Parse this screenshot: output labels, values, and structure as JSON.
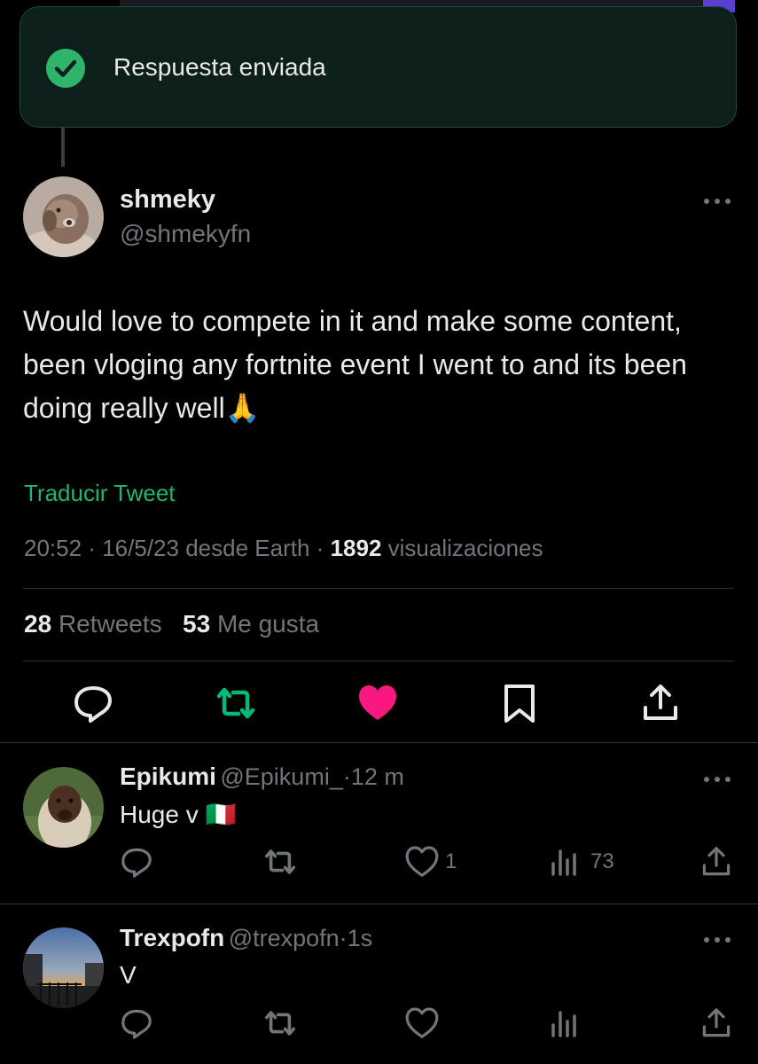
{
  "toast": {
    "message": "Respuesta enviada"
  },
  "tweet": {
    "author_name": "shmeky",
    "author_handle": "@shmekyfn",
    "text": "Would love to compete in it and make some content, been vloging any fortnite event I went to and its been doing really well🙏",
    "translate_label": "Traducir Tweet",
    "time": "20:52",
    "date": "16/5/23",
    "source": "desde Earth",
    "views": "1892",
    "views_label": "visualizaciones",
    "retweets": "28",
    "retweets_label": "Retweets",
    "likes": "53",
    "likes_label": "Me gusta",
    "liked": true,
    "colors": {
      "like": "#f91880",
      "retweet": "#00ba7c",
      "accent": "#1db56f"
    }
  },
  "replies": [
    {
      "name": "Epikumi",
      "handle": "@Epikumi_",
      "time": "12 m",
      "text": "Huge v 🇮🇹",
      "likes": "1",
      "views": "73"
    },
    {
      "name": "Trexpofn",
      "handle": "@trexpofn",
      "time": "1s",
      "text": "V",
      "likes": "",
      "views": ""
    }
  ],
  "separator": "·"
}
